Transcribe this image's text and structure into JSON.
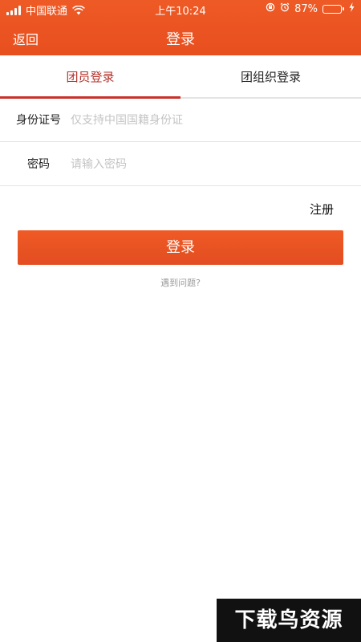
{
  "status_bar": {
    "carrier": "中国联通",
    "time": "上午10:24",
    "battery": "87%",
    "battery_level": 0.87,
    "battery_color": "#4cd964"
  },
  "nav": {
    "back_label": "返回",
    "title": "登录"
  },
  "tabs": [
    {
      "label": "团员登录",
      "active": true
    },
    {
      "label": "团组织登录",
      "active": false
    }
  ],
  "form": {
    "id_label": "身份证号",
    "id_placeholder": "仅支持中国国籍身份证",
    "id_value": "",
    "password_label": "密码",
    "password_placeholder": "请输入密码",
    "password_value": ""
  },
  "register_label": "注册",
  "login_button_label": "登录",
  "help_label": "遇到问题?",
  "watermark_text": "下载鸟资源",
  "colors": {
    "accent": "#e8521f",
    "active_tab": "#b5322a",
    "placeholder": "#c4c4c4"
  },
  "icons": [
    "signal-icon",
    "wifi-icon",
    "alarm-icon",
    "lock-rotation-icon",
    "battery-icon",
    "charging-icon"
  ]
}
